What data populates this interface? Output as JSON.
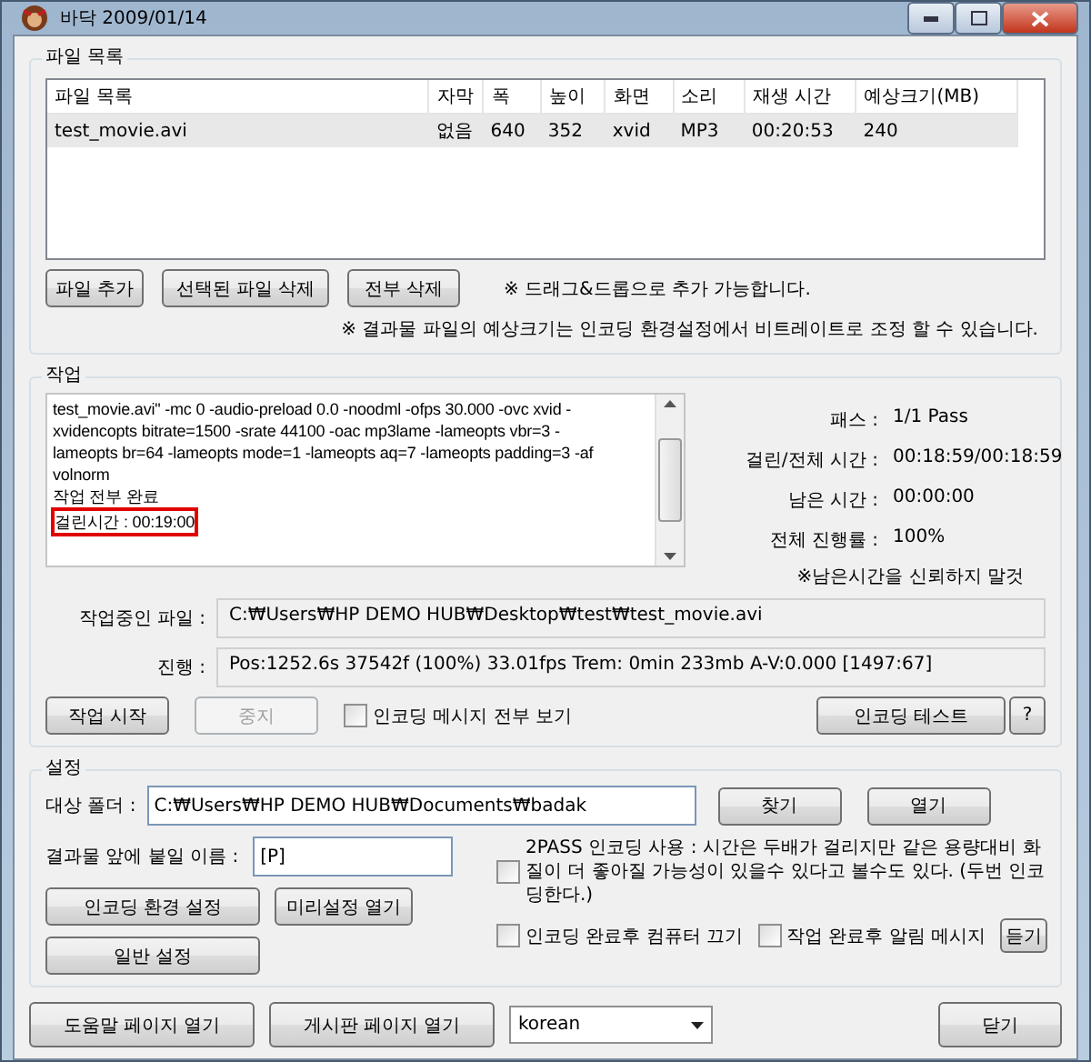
{
  "window": {
    "title": "바닥 2009/01/14"
  },
  "file_list": {
    "title": "파일 목록",
    "columns": [
      "파일 목록",
      "자막",
      "폭",
      "높이",
      "화면",
      "소리",
      "재생 시간",
      "예상크기(MB)"
    ],
    "rows": [
      {
        "cells": [
          "test_movie.avi",
          "없음",
          "640",
          "352",
          "xvid",
          "MP3",
          "00:20:53",
          "240"
        ],
        "selected": true
      }
    ],
    "buttons": [
      "파일 추가",
      "선택된 파일 삭제",
      "전부 삭제"
    ],
    "notes": [
      "※ 드래그&드롭으로 추가 가능합니다.",
      "※ 결과물 파일의 예상크기는 인코딩 환경설정에서 비트레이트로 조정 할 수 있습니다."
    ]
  },
  "job": {
    "title": "작업",
    "log": [
      {
        "text": "test_movie.avi\" -mc 0 -audio-preload 0.0 -noodml -ofps 30.000 -ovc xvid -",
        "highlighted": false
      },
      {
        "text": "xvidencopts bitrate=1500 -srate 44100 -oac mp3lame -lameopts vbr=3  -",
        "highlighted": false
      },
      {
        "text": "lameopts br=64 -lameopts mode=1 -lameopts aq=7 -lameopts padding=3 -af",
        "highlighted": false
      },
      {
        "text": "volnorm",
        "highlighted": false
      },
      {
        "text": "작업 전부 완료",
        "highlighted": false
      },
      {
        "text": "걸린시간 : 00:19:00",
        "highlighted": true
      }
    ],
    "stats": [
      {
        "label": "패스 :",
        "value": "1/1 Pass"
      },
      {
        "label": "걸린/전체 시간 :",
        "value": "00:18:59/00:18:59"
      },
      {
        "label": "남은 시간 :",
        "value": "00:00:00"
      },
      {
        "label": "전체 진행률 :",
        "value": "100%"
      }
    ],
    "warning": "※남은시간을 신뢰하지 말것",
    "fields": [
      {
        "label": "작업중인 파일 :",
        "value": "C:₩Users₩HP DEMO HUB₩Desktop₩test₩test_movie.avi"
      },
      {
        "label": "진행 :",
        "value": "Pos:1252.6s  37542f (100%) 33.01fps Trem:   0min 233mb  A-V:0.000 [1497:67]"
      }
    ],
    "start_button": {
      "label": "작업 시작",
      "disabled": false
    },
    "stop_button": {
      "label": "중지",
      "disabled": true
    },
    "show_all_messages": {
      "label": "인코딩 메시지 전부 보기",
      "checked": false
    },
    "test_button": "인코딩 테스트",
    "help_button": "?"
  },
  "settings": {
    "title": "설정",
    "folder": {
      "label": "대상 폴더 :",
      "value": "C:₩Users₩HP DEMO HUB₩Documents₩badak"
    },
    "browse_button": "찾기",
    "open_button": "열기",
    "prefix": {
      "label": "결과물 앞에 붙일 이름 :",
      "value": "[P]"
    },
    "two_pass": {
      "label": "2PASS 인코딩 사용 : 시간은 두배가 걸리지만 같은 용량대비 화질이 더 좋아질 가능성이 있을수 있다고 볼수도 있다. (두번 인코딩한다.)",
      "checked": false
    },
    "encoding_settings_button": "인코딩 환경 설정",
    "presets_button": "미리설정 열기",
    "general_button": "일반 설정",
    "shutdown": {
      "label": "인코딩 완료후 컴퓨터 끄기",
      "checked": false
    },
    "notify": {
      "label": "작업 완료후 알림 메시지",
      "checked": false
    },
    "listen_button": "듣기"
  },
  "footer": {
    "help_button": "도움말 페이지 열기",
    "board_button": "게시판 페이지 열기",
    "language": "korean",
    "close_button": "닫기"
  }
}
